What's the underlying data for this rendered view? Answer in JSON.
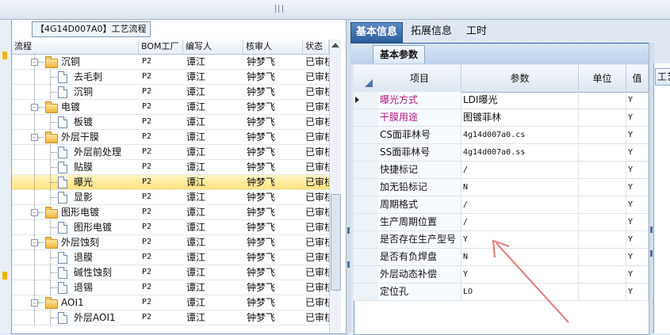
{
  "tree_panel": {
    "title": "【4G14D007A0】工艺流程",
    "columns": [
      "流程",
      "BOM工厂",
      "编写人",
      "核审人",
      "状态"
    ],
    "rows": [
      {
        "level": 1,
        "type": "folder",
        "expander": "-",
        "name": "沉铜",
        "bom": "P2",
        "author": "谭江",
        "reviewer": "钟梦飞",
        "status": "已审核",
        "selected": false
      },
      {
        "level": 2,
        "type": "doc",
        "expander": "",
        "name": "去毛刺",
        "bom": "P2",
        "author": "谭江",
        "reviewer": "钟梦飞",
        "status": "已审核",
        "selected": false
      },
      {
        "level": 2,
        "type": "doc",
        "expander": "",
        "name": "沉铜",
        "bom": "P2",
        "author": "谭江",
        "reviewer": "钟梦飞",
        "status": "已审核",
        "selected": false
      },
      {
        "level": 1,
        "type": "folder",
        "expander": "-",
        "name": "电镀",
        "bom": "P2",
        "author": "谭江",
        "reviewer": "钟梦飞",
        "status": "已审核",
        "selected": false
      },
      {
        "level": 2,
        "type": "doc",
        "expander": "",
        "name": "板镀",
        "bom": "P2",
        "author": "谭江",
        "reviewer": "钟梦飞",
        "status": "已审核",
        "selected": false
      },
      {
        "level": 1,
        "type": "folder",
        "expander": "-",
        "name": "外层干膜",
        "bom": "P2",
        "author": "谭江",
        "reviewer": "钟梦飞",
        "status": "已审核",
        "selected": false
      },
      {
        "level": 2,
        "type": "doc",
        "expander": "",
        "name": "外层前处理",
        "bom": "P2",
        "author": "谭江",
        "reviewer": "钟梦飞",
        "status": "已审核",
        "selected": false
      },
      {
        "level": 2,
        "type": "doc",
        "expander": "",
        "name": "贴膜",
        "bom": "P2",
        "author": "谭江",
        "reviewer": "钟梦飞",
        "status": "已审核",
        "selected": false
      },
      {
        "level": 2,
        "type": "doc",
        "expander": "",
        "name": "曝光",
        "bom": "P2",
        "author": "谭江",
        "reviewer": "钟梦飞",
        "status": "已审核",
        "selected": true
      },
      {
        "level": 2,
        "type": "doc",
        "expander": "",
        "name": "显影",
        "bom": "P2",
        "author": "谭江",
        "reviewer": "钟梦飞",
        "status": "已审核",
        "selected": false
      },
      {
        "level": 1,
        "type": "folder",
        "expander": "-",
        "name": "图形电镀",
        "bom": "P2",
        "author": "谭江",
        "reviewer": "钟梦飞",
        "status": "已审核",
        "selected": false
      },
      {
        "level": 2,
        "type": "doc",
        "expander": "",
        "name": "图形电镀",
        "bom": "P2",
        "author": "谭江",
        "reviewer": "钟梦飞",
        "status": "已审核",
        "selected": false
      },
      {
        "level": 1,
        "type": "folder",
        "expander": "-",
        "name": "外层蚀刻",
        "bom": "P2",
        "author": "谭江",
        "reviewer": "钟梦飞",
        "status": "已审核",
        "selected": false
      },
      {
        "level": 2,
        "type": "doc",
        "expander": "",
        "name": "退膜",
        "bom": "P2",
        "author": "谭江",
        "reviewer": "钟梦飞",
        "status": "已审核",
        "selected": false
      },
      {
        "level": 2,
        "type": "doc",
        "expander": "",
        "name": "碱性蚀刻",
        "bom": "P2",
        "author": "谭江",
        "reviewer": "钟梦飞",
        "status": "已审核",
        "selected": false
      },
      {
        "level": 2,
        "type": "doc",
        "expander": "",
        "name": "退锡",
        "bom": "P2",
        "author": "谭江",
        "reviewer": "钟梦飞",
        "status": "已审核",
        "selected": false
      },
      {
        "level": 1,
        "type": "folder",
        "expander": "-",
        "name": "AOI1",
        "bom": "P2",
        "author": "谭江",
        "reviewer": "钟梦飞",
        "status": "已审核",
        "selected": false
      },
      {
        "level": 2,
        "type": "doc",
        "expander": "",
        "name": "外层AOI1",
        "bom": "P2",
        "author": "谭江",
        "reviewer": "钟梦飞",
        "status": "已审核",
        "selected": false
      }
    ]
  },
  "right_panel": {
    "tabs": [
      "基本信息",
      "拓展信息",
      "工时"
    ],
    "active_tab": 0,
    "subtab": "基本参数",
    "columns": [
      "项目",
      "参数",
      "单位",
      "值"
    ],
    "rows": [
      {
        "item": "曝光方式",
        "value": "LDI曝光",
        "unit": "",
        "flag": "Y",
        "highlight": true,
        "current": true
      },
      {
        "item": "干膜用途",
        "value": "图镀菲林",
        "unit": "",
        "flag": "Y",
        "highlight": true,
        "current": false
      },
      {
        "item": "CS面菲林号",
        "value": "4g14d007a0.cs",
        "unit": "",
        "flag": "Y",
        "highlight": false,
        "current": false
      },
      {
        "item": "SS面菲林号",
        "value": "4g14d007a0.ss",
        "unit": "",
        "flag": "Y",
        "highlight": false,
        "current": false
      },
      {
        "item": "快捷标记",
        "value": "/",
        "unit": "",
        "flag": "Y",
        "highlight": false,
        "current": false
      },
      {
        "item": "加无铅标记",
        "value": "N",
        "unit": "",
        "flag": "Y",
        "highlight": false,
        "current": false
      },
      {
        "item": "周期格式",
        "value": "/",
        "unit": "",
        "flag": "Y",
        "highlight": false,
        "current": false
      },
      {
        "item": "生产周期位置",
        "value": "/",
        "unit": "",
        "flag": "Y",
        "highlight": false,
        "current": false
      },
      {
        "item": "是否存在生产型号",
        "value": "Y",
        "unit": "",
        "flag": "Y",
        "highlight": false,
        "current": false
      },
      {
        "item": "是否有负焊盘",
        "value": "N",
        "unit": "",
        "flag": "Y",
        "highlight": false,
        "current": false
      },
      {
        "item": "外层动态补偿",
        "value": "Y",
        "unit": "",
        "flag": "Y",
        "highlight": false,
        "current": false
      },
      {
        "item": "定位孔",
        "value": "LO",
        "unit": "",
        "flag": "Y",
        "highlight": false,
        "current": false
      }
    ],
    "far_tab": "工艺"
  },
  "colors": {
    "highlight_text": "#b0197c",
    "annotation_arrow": "#e07a76",
    "tab_active": "#2e5f9f"
  }
}
